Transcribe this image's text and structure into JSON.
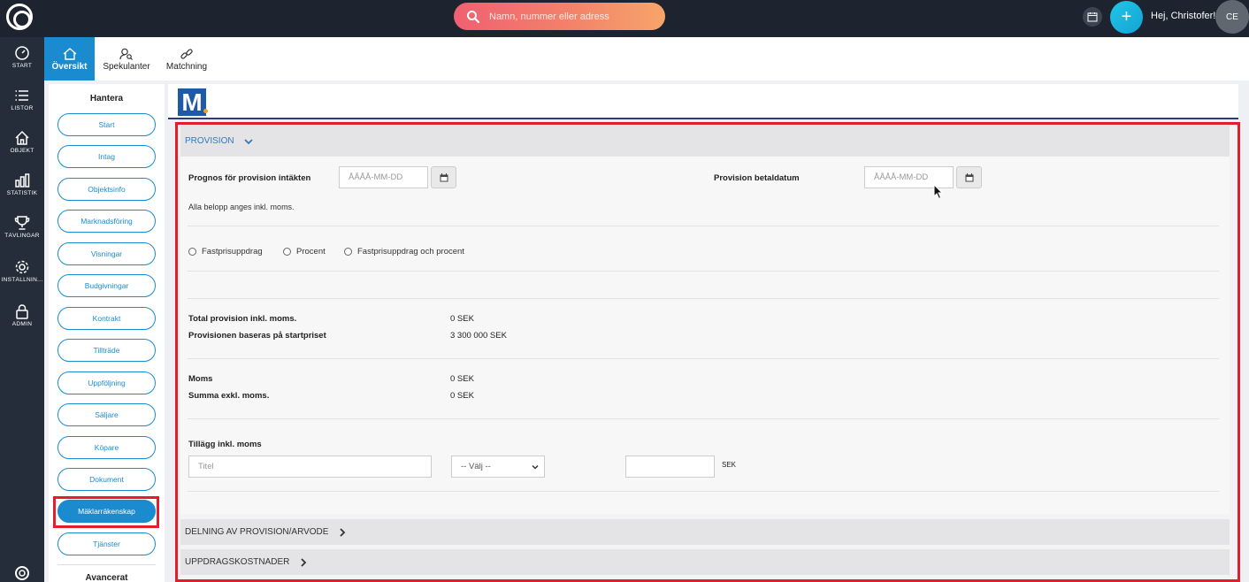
{
  "header": {
    "search_placeholder": "Namn, nummer eller adress",
    "greeting": "Hej, Christofer!",
    "avatar_initials": "CE",
    "plus_label": "+"
  },
  "rail": {
    "items": [
      {
        "label": "START",
        "icon": "speedometer-icon"
      },
      {
        "label": "LISTOR",
        "icon": "list-icon"
      },
      {
        "label": "OBJEKT",
        "icon": "home-icon"
      },
      {
        "label": "STATISTIK",
        "icon": "bar-chart-icon"
      },
      {
        "label": "TÄVLINGAR",
        "icon": "trophy-icon"
      },
      {
        "label": "INSTÄLLNIN...",
        "icon": "gear-icon"
      },
      {
        "label": "ADMIN",
        "icon": "lock-icon"
      }
    ],
    "help_icon": "lifebuoy-icon"
  },
  "tabs": [
    {
      "label": "Översikt",
      "icon": "home-icon",
      "active": true
    },
    {
      "label": "Spekulanter",
      "icon": "person-search-icon",
      "active": false
    },
    {
      "label": "Matchning",
      "icon": "link-icon",
      "active": false
    }
  ],
  "sidemenu": {
    "title": "Hantera",
    "items": [
      "Start",
      "Intag",
      "Objektsinfo",
      "Marknadsföring",
      "Visningar",
      "Budgivningar",
      "Kontrakt",
      "Tillträde",
      "Uppföljning",
      "Säljare",
      "Köpare",
      "Dokument",
      "Mäklarräkenskap",
      "Tjänster"
    ],
    "active_item": "Mäklarräkenskap",
    "footer_title": "Avancerat"
  },
  "brand": {
    "letter": "M"
  },
  "provision": {
    "section_title": "PROVISION",
    "prognos_label": "Prognos för provision intäkten",
    "prognos_placeholder": "ÅÅÅÅ-MM-DD",
    "betaldatum_label": "Provision betaldatum",
    "betaldatum_placeholder": "ÅÅÅÅ-MM-DD",
    "moms_note": "Alla belopp anges inkl. moms.",
    "radio_options": [
      "Fastprisuppdrag",
      "Procent",
      "Fastprisuppdrag och procent"
    ],
    "total_label": "Total provision inkl. moms.",
    "total_value": "0 SEK",
    "baseras_label": "Provisionen baseras på startpriset",
    "baseras_value": "3 300 000 SEK",
    "moms_label": "Moms",
    "moms_value": "0 SEK",
    "summa_label": "Summa exkl. moms.",
    "summa_value": "0 SEK",
    "tillagg_label": "Tillägg inkl. moms",
    "titel_placeholder": "Titel",
    "valj_label": "-- Välj --",
    "sek_unit": "SEK"
  },
  "sections": {
    "delning": "DELNING AV PROVISION/ARVODE",
    "uppdrag": "UPPDRAGSKOSTNADER"
  },
  "colors": {
    "accent": "#1b8bd0",
    "highlight": "#e01e2e",
    "topbar": "#1d2430"
  }
}
